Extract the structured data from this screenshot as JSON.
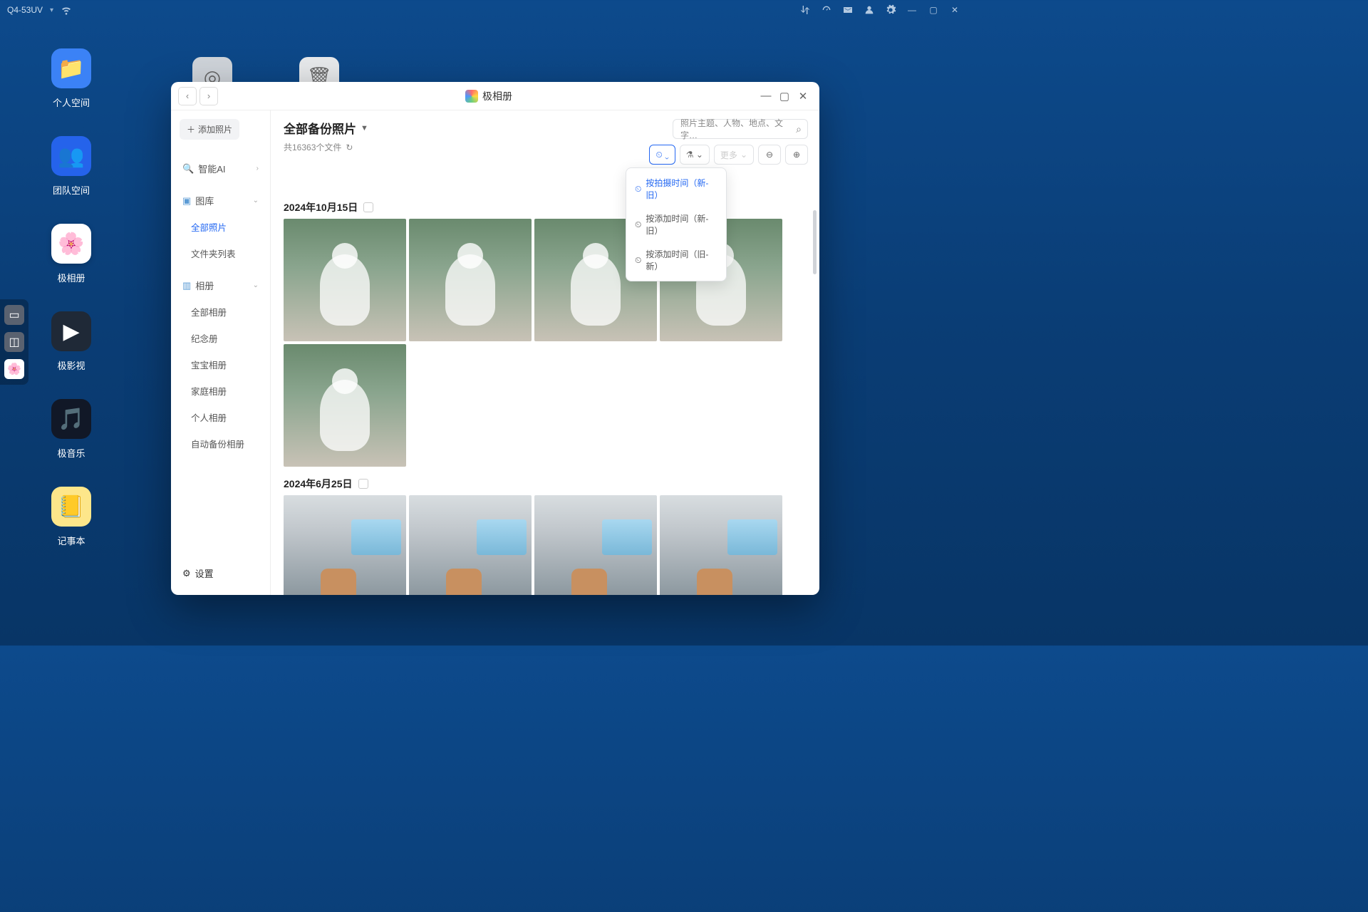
{
  "topbar": {
    "device": "Q4-53UV"
  },
  "dock": [
    {
      "label": "个人空间",
      "bg": "#3b82f6",
      "glyph": "📁"
    },
    {
      "label": "团队空间",
      "bg": "#2563eb",
      "glyph": "👥"
    },
    {
      "label": "极相册",
      "bg": "#ffffff",
      "glyph": "🌸"
    },
    {
      "label": "极影视",
      "bg": "#1f2937",
      "glyph": "▶"
    },
    {
      "label": "极音乐",
      "bg": "#111827",
      "glyph": "🎵"
    },
    {
      "label": "记事本",
      "bg": "#fde68a",
      "glyph": "📒"
    }
  ],
  "window": {
    "title": "极相册",
    "add_photo": "添加照片",
    "sidebar": {
      "ai": "智能AI",
      "gallery": "图库",
      "gallery_items": [
        "全部照片",
        "文件夹列表"
      ],
      "album": "相册",
      "album_items": [
        "全部相册",
        "纪念册",
        "宝宝相册",
        "家庭相册",
        "个人相册",
        "自动备份相册"
      ],
      "settings": "设置"
    },
    "content": {
      "title": "全部备份照片",
      "count_text": "共16363个文件",
      "search_placeholder": "照片主题、人物、地点、文字…",
      "more": "更多",
      "sort_options": [
        "按拍摄时间（新-旧）",
        "按添加时间（新-旧）",
        "按添加时间（旧-新）"
      ],
      "groups": [
        {
          "date": "2024年10月15日",
          "count": 5,
          "variant": "rain"
        },
        {
          "date": "2024年6月25日",
          "count": 4,
          "variant": "train"
        }
      ]
    }
  }
}
